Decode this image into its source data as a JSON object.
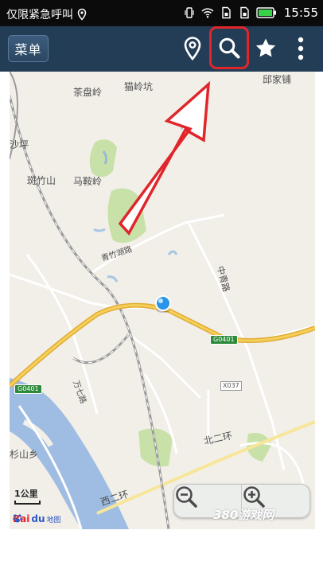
{
  "status_bar": {
    "notice": "仅限紧急呼叫",
    "time": "15:55"
  },
  "toolbar": {
    "menu_label": "菜单",
    "icons": [
      "location-pin-icon",
      "search-icon",
      "star-icon",
      "more-vertical-icon"
    ],
    "highlight_color": "#e0262b",
    "background_color": "#233d57"
  },
  "map": {
    "labels": {
      "chapanling": "茶盘岭",
      "maolingkeng": "猫岭坑",
      "zhangjiapu": "邱家铺",
      "shaping": "沙坪",
      "banzhushan": "斑竹山",
      "maanling": "马鞍岭",
      "qingzhuhulu": "青竹湖路",
      "zhongqinglu": "中青路",
      "shanshanxiang": "杉山乡",
      "beierhuan": "北二环",
      "xierhuan": "西二环",
      "wanqilu": "万七路"
    },
    "road_badges": {
      "g0401_right": "G0401",
      "g0401_left": "G0401",
      "x037": "X037"
    },
    "scale_label": "1公里",
    "logo": {
      "bai": "Bai",
      "du": "du",
      "sub": "地图"
    },
    "zoom_icons": [
      "zoom-out-icon",
      "zoom-in-icon"
    ]
  },
  "watermark": "380游戏网"
}
